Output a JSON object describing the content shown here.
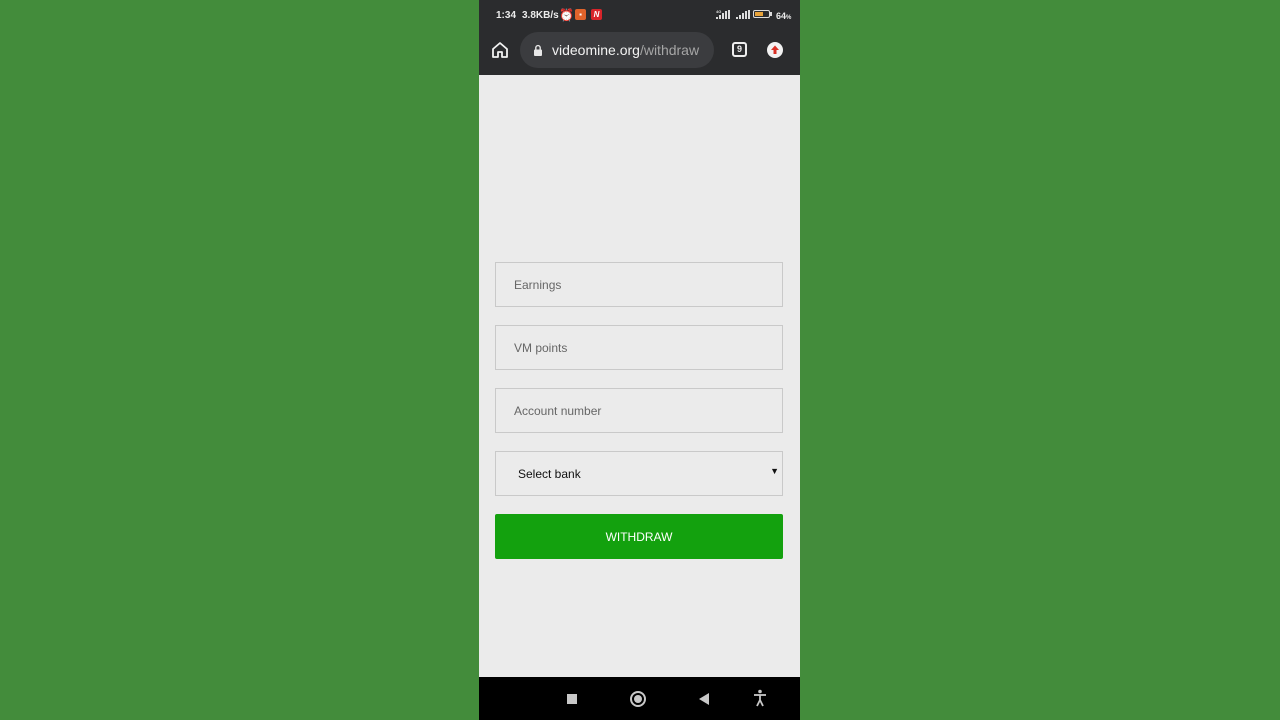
{
  "status_bar": {
    "time": "1:34",
    "speed": "3.8KB/s",
    "network": "4G",
    "battery": "64",
    "battery_level": 0.64
  },
  "browser": {
    "url_host": "videomine.org",
    "url_path": "/withdraw",
    "tab_count": "9"
  },
  "form": {
    "earnings_placeholder": "Earnings",
    "vm_points_placeholder": "VM points",
    "account_number_placeholder": "Account number",
    "bank_select_label": "Select bank",
    "withdraw_label": "WITHDRAW"
  },
  "colors": {
    "background": "#438c3b",
    "button": "#13a10e",
    "toolbar": "#2b2c2e"
  },
  "icons": [
    "home-icon",
    "lock-icon",
    "tabs-icon",
    "update-icon",
    "alarm-icon",
    "recents-icon",
    "nav-home-icon",
    "back-icon",
    "accessibility-icon"
  ]
}
